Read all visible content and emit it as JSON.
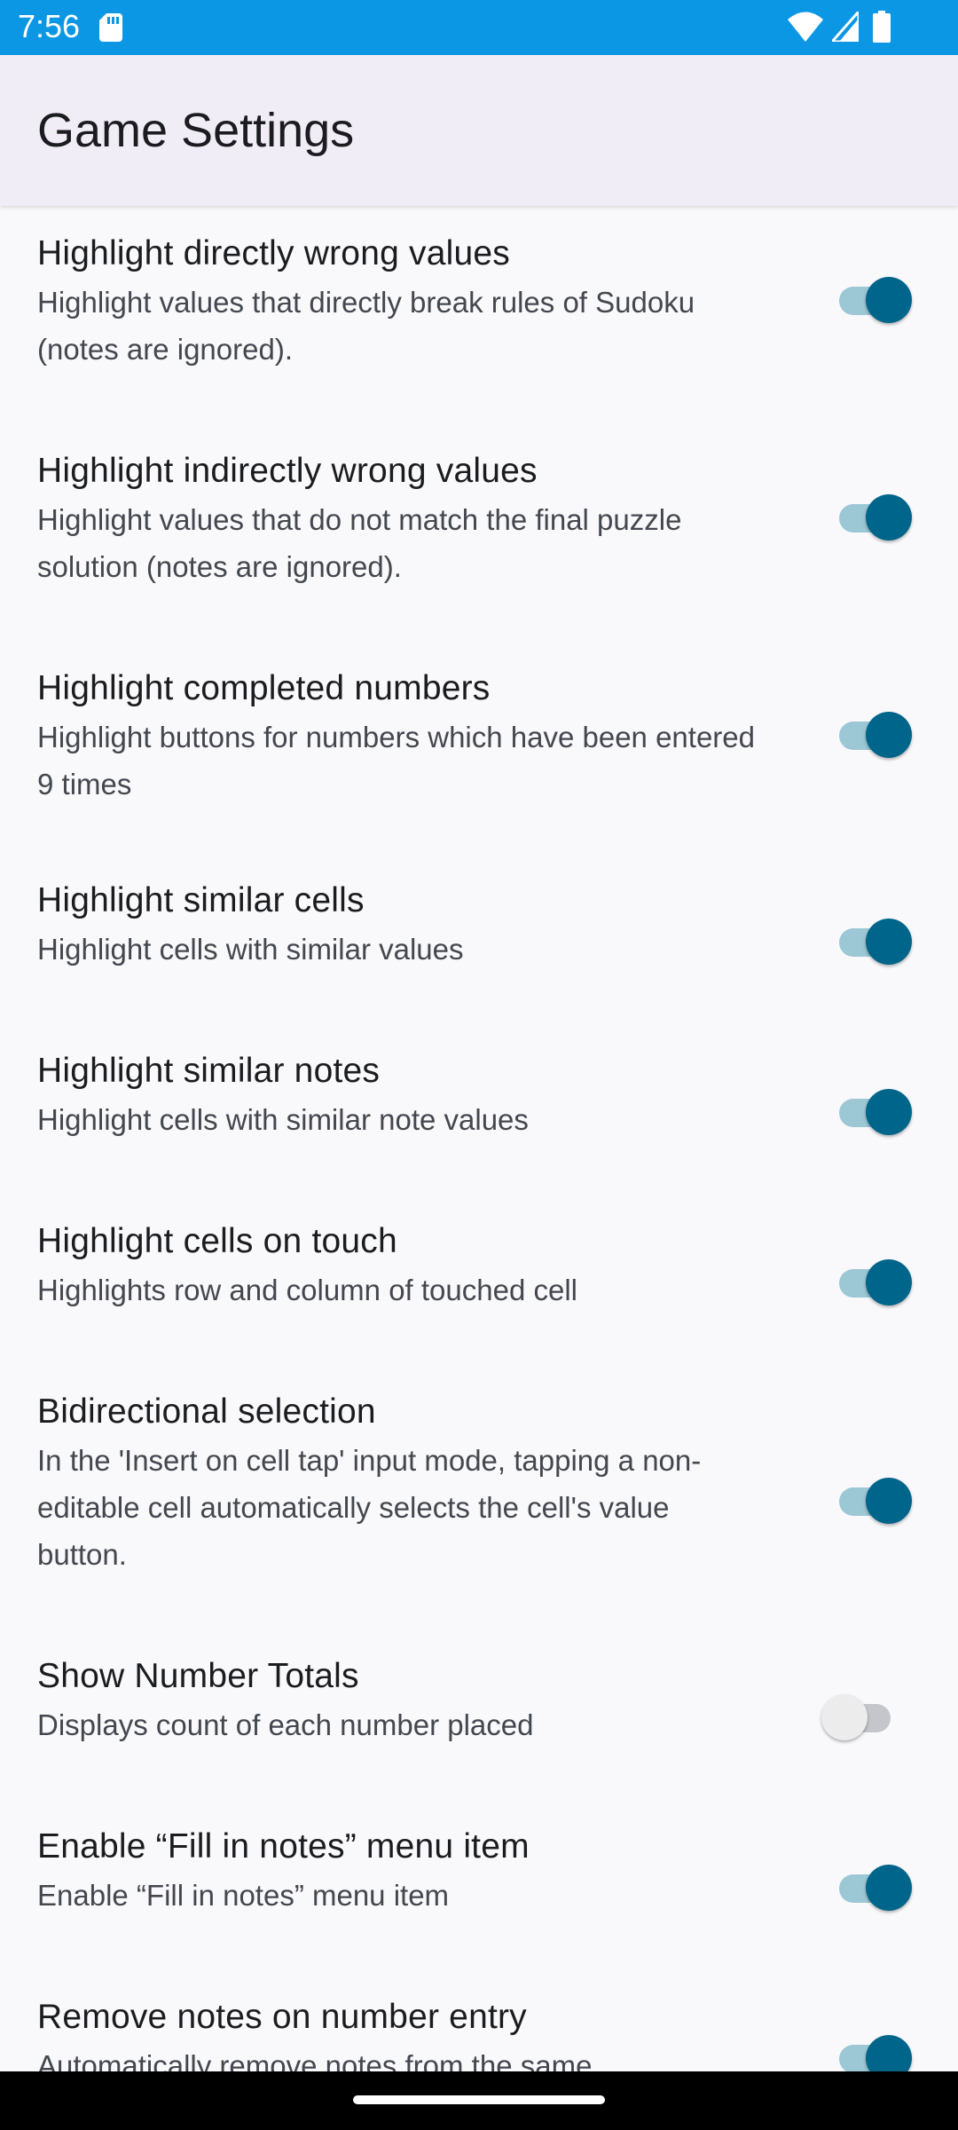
{
  "status_bar": {
    "time": "7:56",
    "icons": [
      "sd-card-icon",
      "wifi-icon",
      "cellular-signal-icon",
      "battery-icon"
    ]
  },
  "app_bar": {
    "title": "Game Settings"
  },
  "colors": {
    "status_bar": "#0B97E3",
    "app_bar": "#F1EDF7",
    "background": "#F9F9FC",
    "switch_on_thumb": "#00658A",
    "switch_on_track": "#9CC7D4",
    "switch_off_thumb": "#ECECEC",
    "switch_off_track": "#C4C6CC"
  },
  "settings": [
    {
      "title": "Highlight directly wrong values",
      "summary": "Highlight values that directly break rules of Sudoku (notes are ignored).",
      "enabled": true
    },
    {
      "title": "Highlight indirectly wrong values",
      "summary": "Highlight values that do not match the final puzzle solution (notes are ignored).",
      "enabled": true
    },
    {
      "title": "Highlight completed numbers",
      "summary": "Highlight buttons for numbers which have been entered 9 times",
      "enabled": true
    },
    {
      "title": "Highlight similar cells",
      "summary": "Highlight cells with similar values",
      "enabled": true
    },
    {
      "title": "Highlight similar notes",
      "summary": "Highlight cells with similar note values",
      "enabled": true
    },
    {
      "title": "Highlight cells on touch",
      "summary": "Highlights row and column of touched cell",
      "enabled": true
    },
    {
      "title": "Bidirectional selection",
      "summary": "In the 'Insert on cell tap' input mode, tapping a non-editable cell automatically selects the cell's value button.",
      "enabled": true
    },
    {
      "title": "Show Number Totals",
      "summary": "Displays count of each number placed",
      "enabled": false
    },
    {
      "title": "Enable “Fill in notes” menu item",
      "summary": "Enable “Fill in notes” menu item",
      "enabled": true
    },
    {
      "title": "Remove notes on number entry",
      "summary": "Automatically remove notes from the same",
      "enabled": true
    }
  ]
}
